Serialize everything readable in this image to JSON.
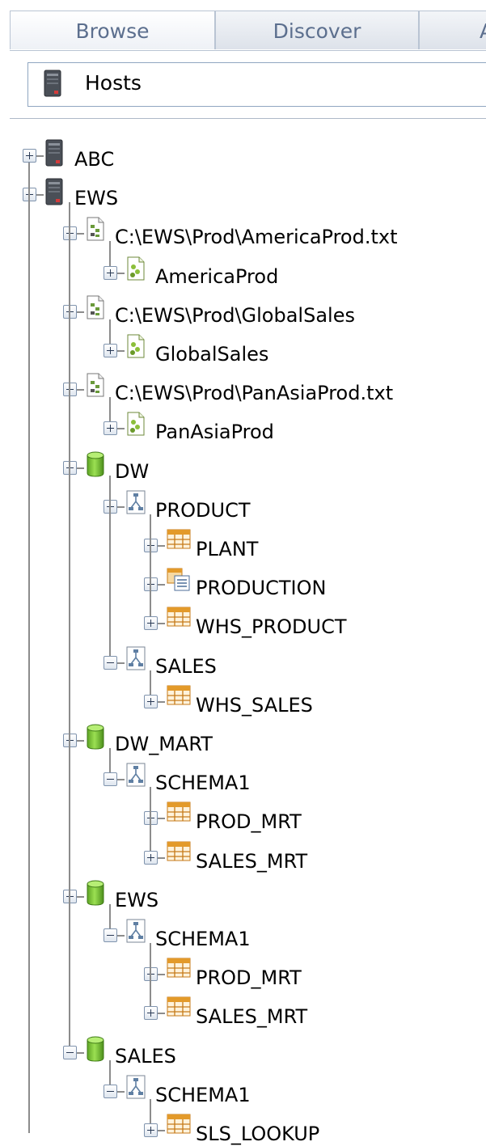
{
  "tabs": [
    {
      "label": "Browse",
      "active": true
    },
    {
      "label": "Discover",
      "active": false
    },
    {
      "label": "A",
      "active": false
    }
  ],
  "host_selector": {
    "label": "Hosts",
    "icon": "server-icon"
  },
  "tree": [
    {
      "label": "ABC",
      "icon": "server-icon",
      "expanded": false
    },
    {
      "label": "EWS",
      "icon": "server-icon",
      "expanded": true
    },
    {
      "label": "C:\\EWS\\Prod\\AmericaProd.txt",
      "icon": "file-icon",
      "expanded": true
    },
    {
      "label": "AmericaProd",
      "icon": "datasource-icon",
      "expanded": false
    },
    {
      "label": "C:\\EWS\\Prod\\GlobalSales",
      "icon": "file-icon",
      "expanded": true
    },
    {
      "label": "GlobalSales",
      "icon": "datasource-icon",
      "expanded": false
    },
    {
      "label": "C:\\EWS\\Prod\\PanAsiaProd.txt",
      "icon": "file-icon",
      "expanded": true
    },
    {
      "label": "PanAsiaProd",
      "icon": "datasource-icon",
      "expanded": false
    },
    {
      "label": "DW",
      "icon": "database-icon",
      "expanded": true
    },
    {
      "label": "PRODUCT",
      "icon": "schema-icon",
      "expanded": true
    },
    {
      "label": "PLANT",
      "icon": "table-icon",
      "expanded": false
    },
    {
      "label": "PRODUCTION",
      "icon": "view-icon",
      "expanded": false
    },
    {
      "label": "WHS_PRODUCT",
      "icon": "table-icon",
      "expanded": false
    },
    {
      "label": "SALES",
      "icon": "schema-icon",
      "expanded": true
    },
    {
      "label": "WHS_SALES",
      "icon": "table-icon",
      "expanded": false
    },
    {
      "label": "DW_MART",
      "icon": "database-icon",
      "expanded": true
    },
    {
      "label": "SCHEMA1",
      "icon": "schema-icon",
      "expanded": true
    },
    {
      "label": "PROD_MRT",
      "icon": "table-icon",
      "expanded": false
    },
    {
      "label": "SALES_MRT",
      "icon": "table-icon",
      "expanded": false
    },
    {
      "label": "EWS",
      "icon": "database-icon",
      "expanded": true
    },
    {
      "label": "SCHEMA1",
      "icon": "schema-icon",
      "expanded": true
    },
    {
      "label": "PROD_MRT",
      "icon": "table-icon",
      "expanded": false
    },
    {
      "label": "SALES_MRT",
      "icon": "table-icon",
      "expanded": false
    },
    {
      "label": "SALES",
      "icon": "database-icon",
      "expanded": true
    },
    {
      "label": "SCHEMA1",
      "icon": "schema-icon",
      "expanded": true
    },
    {
      "label": "SLS_LOOKUP",
      "icon": "table-icon",
      "expanded": false
    }
  ],
  "colors": {
    "tab_text": "#5c6f8e",
    "tree_line": "#8c8c8c",
    "database_green": "#7cc23a",
    "table_orange": "#e39a2a"
  }
}
